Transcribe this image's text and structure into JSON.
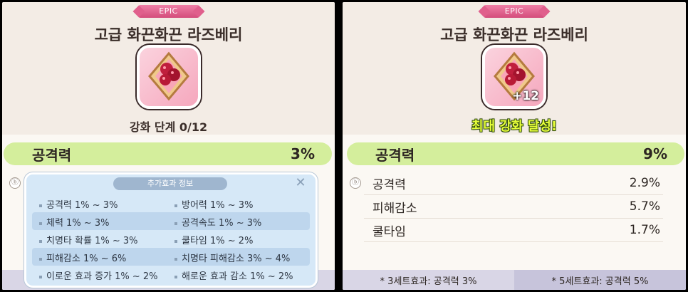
{
  "left": {
    "rarity": "EPIC",
    "title": "고급 화끈화끈 라즈베리",
    "icon": "raspberry-topping-icon",
    "enhance_level": "강화 단계 0/12",
    "main_stat": {
      "name": "공격력",
      "value": "3%"
    },
    "info_icon": "ⓑ",
    "popup": {
      "header": "추가효과 정보",
      "close_icon": "close-icon",
      "options": [
        [
          "공격력 1% ~ 3%",
          "방어력 1% ~ 3%"
        ],
        [
          "체력 1% ~ 3%",
          "공격속도 1% ~ 3%"
        ],
        [
          "치명타 확률 1% ~ 3%",
          "쿨타임 1% ~ 2%"
        ],
        [
          "피해감소 1% ~ 6%",
          "치명타 피해감소 3% ~ 4%"
        ],
        [
          "이로운 효과 증가 1% ~ 2%",
          "해로운 효과 감소 1% ~ 2%"
        ]
      ]
    }
  },
  "right": {
    "rarity": "EPIC",
    "title": "고급 화끈화끈 라즈베리",
    "icon": "raspberry-topping-icon",
    "enhance_badge": "+12",
    "max_text": "최대 강화 달성!",
    "main_stat": {
      "name": "공격력",
      "value": "9%"
    },
    "info_icon": "ⓑ",
    "sub_stats": [
      {
        "name": "공격력",
        "value": "2.9%"
      },
      {
        "name": "피해감소",
        "value": "5.7%"
      },
      {
        "name": "쿨타임",
        "value": "1.7%"
      }
    ],
    "set_effects": [
      "* 3세트효과: 공격력 3%",
      "* 5세트효과: 공격력 5%"
    ]
  },
  "colors": {
    "epic": "#e05f8c",
    "stat_bar": "#d4ee9c",
    "popup_bg": "#d6e8f7",
    "max_text": "#e7ff3a"
  }
}
